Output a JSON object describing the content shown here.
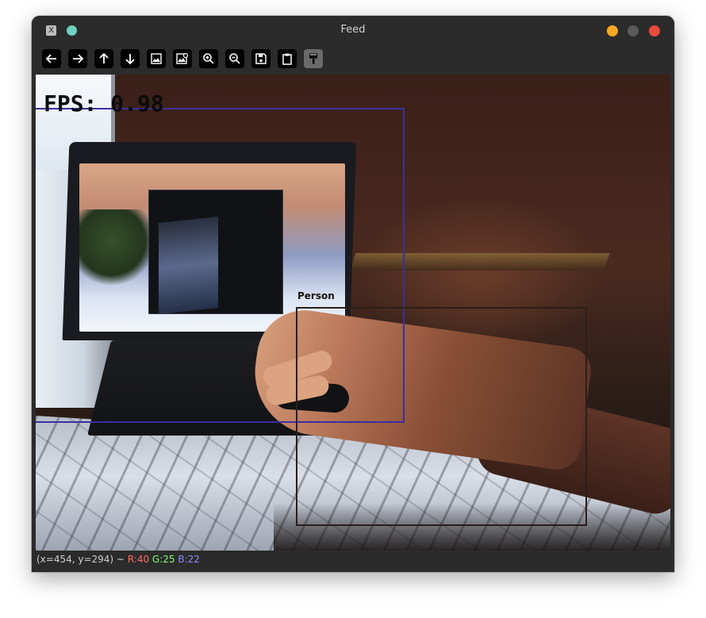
{
  "window": {
    "title": "Feed",
    "app_icon_glyph": "X"
  },
  "toolbar": {
    "buttons": [
      {
        "name": "pan-left",
        "icon": "arrow-left-icon"
      },
      {
        "name": "pan-right",
        "icon": "arrow-right-icon"
      },
      {
        "name": "pan-up",
        "icon": "arrow-up-icon"
      },
      {
        "name": "pan-down",
        "icon": "arrow-down-icon"
      },
      {
        "name": "zoom-fit",
        "icon": "image-icon"
      },
      {
        "name": "zoom-original",
        "icon": "image-zoom-icon"
      },
      {
        "name": "zoom-in",
        "icon": "zoom-in-icon"
      },
      {
        "name": "zoom-out",
        "icon": "zoom-out-icon"
      },
      {
        "name": "save",
        "icon": "save-icon"
      },
      {
        "name": "copy-clipboard",
        "icon": "clipboard-icon"
      },
      {
        "name": "properties",
        "icon": "paint-brush-icon"
      }
    ]
  },
  "overlay": {
    "fps_text": "FPS: 0.98",
    "person_label": "Person"
  },
  "status": {
    "coords": "(x=454, y=294) ~",
    "r": "R:40",
    "g": "G:25",
    "b": "B:22"
  },
  "colors": {
    "laptop_box": "#3c2fa0",
    "person_box": "#2c1e1a",
    "close": "#e74c3c",
    "minimize": "#f5a623"
  }
}
